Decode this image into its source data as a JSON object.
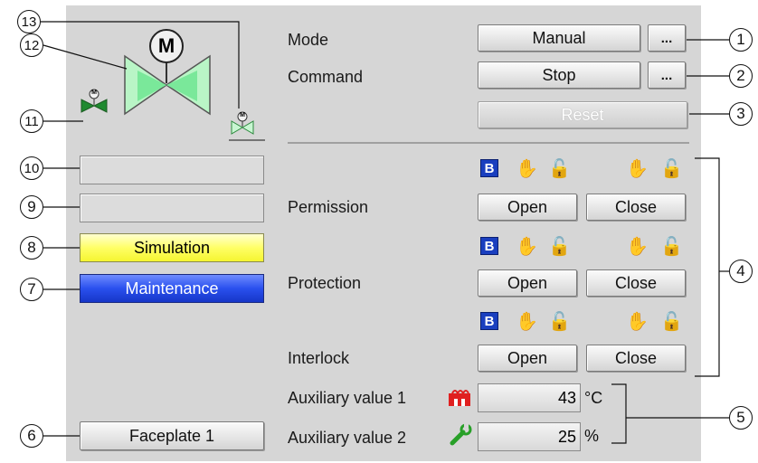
{
  "callouts": [
    "1",
    "2",
    "3",
    "4",
    "5",
    "6",
    "7",
    "8",
    "9",
    "10",
    "11",
    "12",
    "13"
  ],
  "motor_label": "M",
  "mode": {
    "label": "Mode",
    "value": "Manual",
    "more": "..."
  },
  "command": {
    "label": "Command",
    "value": "Stop",
    "more": "..."
  },
  "reset": {
    "label": "Reset"
  },
  "status": {
    "simulation": "Simulation",
    "maintenance": "Maintenance"
  },
  "faceplate": {
    "label": "Faceplate 1"
  },
  "bypass_badge": "B",
  "permission": {
    "label": "Permission",
    "open": "Open",
    "close": "Close"
  },
  "protection": {
    "label": "Protection",
    "open": "Open",
    "close": "Close"
  },
  "interlock": {
    "label": "Interlock",
    "open": "Open",
    "close": "Close"
  },
  "aux1": {
    "label": "Auxiliary value 1",
    "value": "43",
    "unit": "°C"
  },
  "aux2": {
    "label": "Auxiliary value 2",
    "value": "25",
    "unit": "%"
  },
  "colors": {
    "simulation": "#ffff66",
    "maintenance": "#2a50ee",
    "valve_green": "#66e088"
  }
}
